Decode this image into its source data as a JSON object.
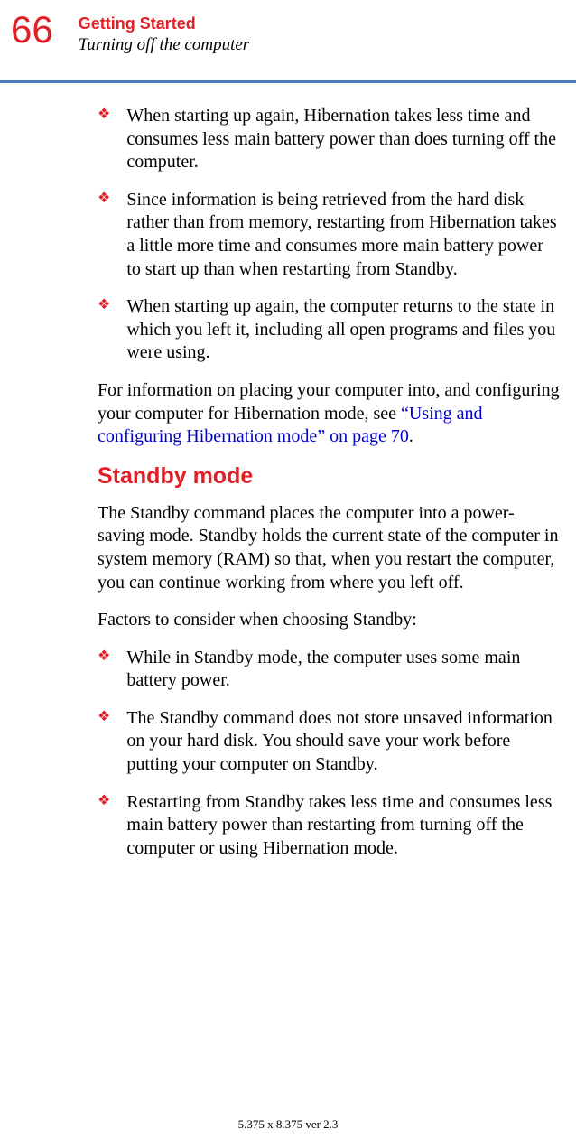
{
  "header": {
    "pageNumber": "66",
    "chapterTitle": "Getting Started",
    "sectionTitle": "Turning off the computer"
  },
  "content": {
    "bullets1": [
      "When starting up again, Hibernation takes less time and consumes less main battery power than does turning off the computer.",
      "Since information is being retrieved from the hard disk rather than from memory, restarting from Hibernation takes a little more time and consumes more main battery power to start up than when restarting from Standby.",
      "When starting up again, the computer returns to the state in which you left it, including all open programs and files you were using."
    ],
    "paragraph1_pre": "For information on placing your computer into, and configuring your computer for Hibernation mode, see ",
    "paragraph1_link": "“Using and configuring Hibernation mode” on page 70",
    "paragraph1_post": ".",
    "sectionHeading": "Standby mode",
    "paragraph2": "The Standby command places the computer into a power-saving mode. Standby holds the current state of the computer in system memory (RAM) so that, when you restart the computer, you can continue working from where you left off.",
    "paragraph3": "Factors to consider when choosing Standby:",
    "bullets2": [
      "While in Standby mode, the computer uses some main battery power.",
      "The Standby command does not store unsaved information on your hard disk. You should save your work before putting your computer on Standby.",
      "Restarting from Standby takes less time and consumes less main battery power than restarting from turning off the computer or using Hibernation mode."
    ]
  },
  "footer": "5.375 x 8.375 ver 2.3"
}
